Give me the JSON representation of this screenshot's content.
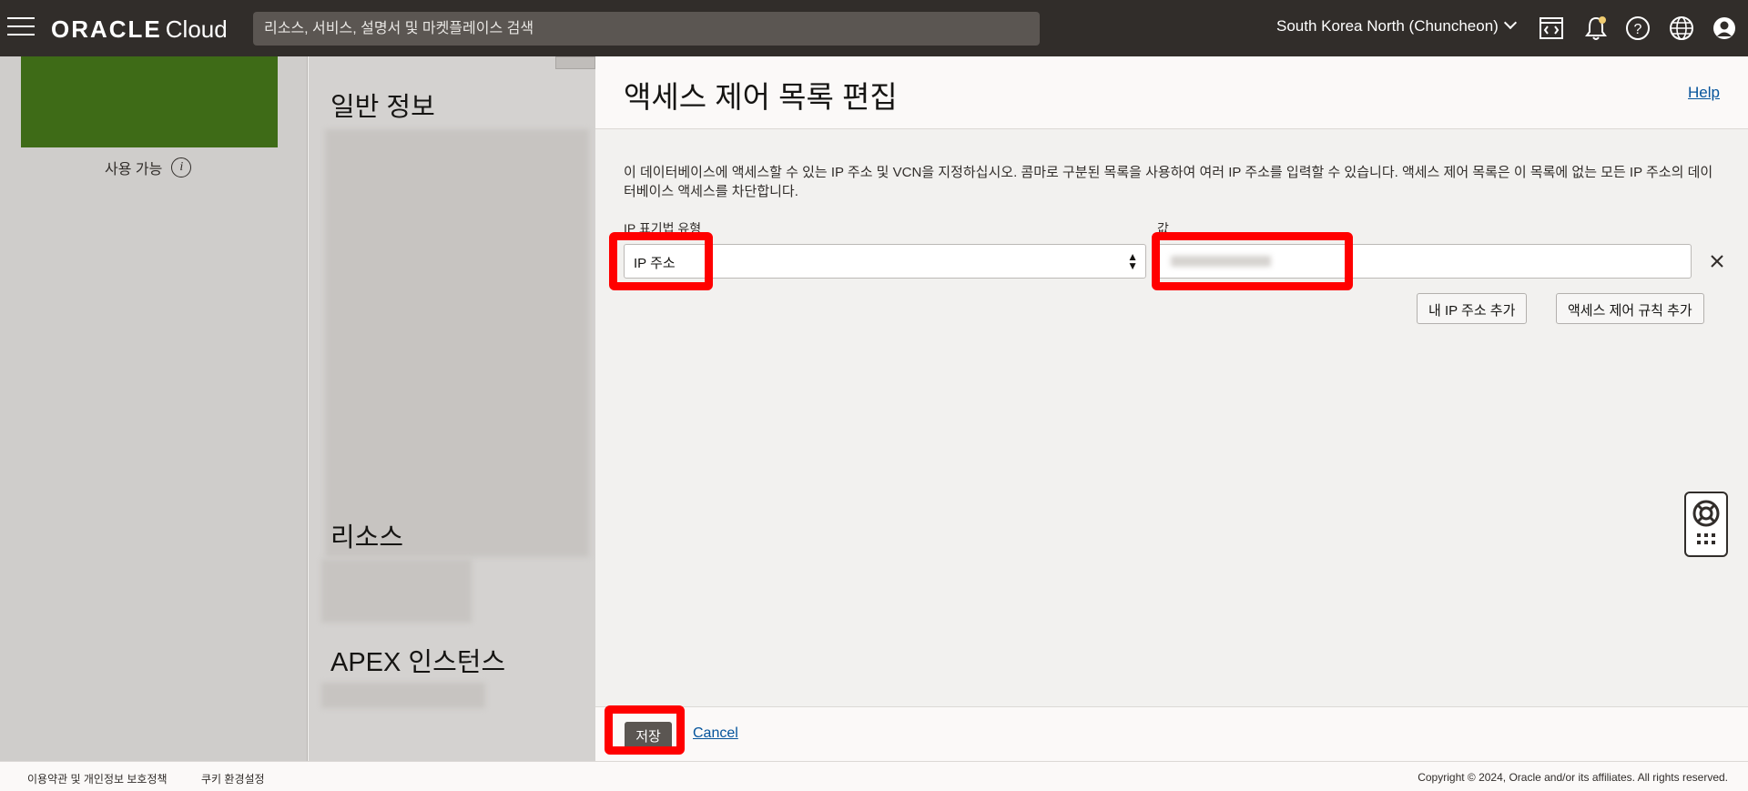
{
  "header": {
    "logo_brand": "ORACLE",
    "logo_product": "Cloud",
    "search_placeholder": "리소스, 서비스, 설명서 및 마켓플레이스 검색",
    "region": "South Korea North (Chuncheon)",
    "icons": [
      "menu-icon",
      "code-editor-icon",
      "bell-icon",
      "help-icon",
      "globe-icon",
      "user-icon"
    ]
  },
  "background": {
    "status_label": "사용 가능",
    "sections": [
      "일반 정보",
      "리소스",
      "APEX 인스턴스"
    ]
  },
  "panel": {
    "title": "액세스 제어 목록 편집",
    "help": "Help",
    "description": "이 데이터베이스에 액세스할 수 있는 IP 주소 및 VCN을 지정하십시오. 콤마로 구분된 목록을 사용하여 여러 IP 주소를 입력할 수 있습니다. 액세스 제어 목록은 이 목록에 없는 모든 IP 주소의 데이터베이스 액세스를 차단합니다.",
    "notation_label": "IP 표기법 유형",
    "notation_value": "IP 주소",
    "value_label": "값",
    "add_my_ip": "내 IP 주소 추가",
    "add_rule": "액세스 제어 규칙 추가",
    "save": "저장",
    "cancel": "Cancel"
  },
  "footer": {
    "terms": "이용약관 및 개인정보 보호정책",
    "cookies": "쿠키 환경설정",
    "copyright": "Copyright © 2024, Oracle and/or its affiliates. All rights reserved."
  },
  "colors": {
    "topbar": "#312d2a",
    "highlight": "#ff0000",
    "link": "#04539b",
    "status_green": "#3e6b17"
  }
}
